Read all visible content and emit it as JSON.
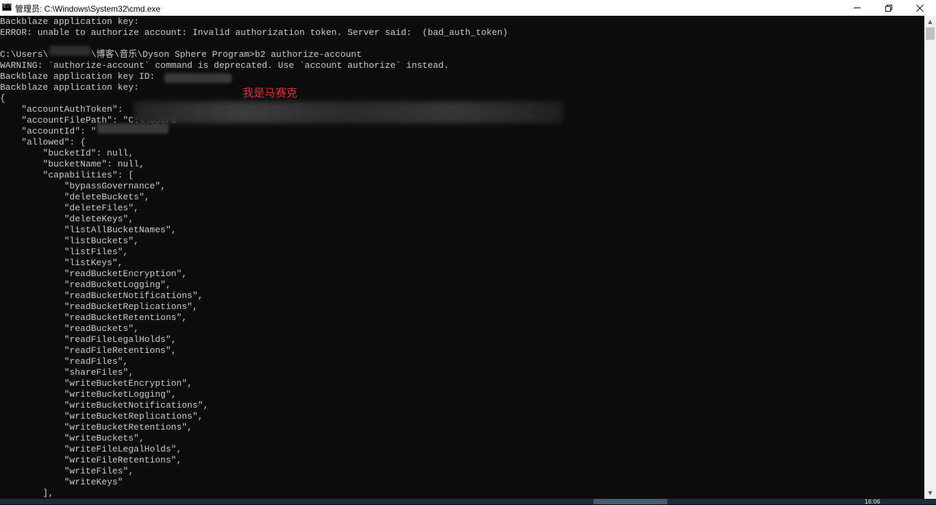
{
  "window": {
    "title": "管理员: C:\\Windows\\System32\\cmd.exe",
    "app_icon_text": "C:\\",
    "controls": {
      "minimize": "minimize",
      "maximize": "restore",
      "close": "close"
    }
  },
  "console": {
    "lines": [
      "Backblaze application key:",
      "ERROR: unable to authorize account: Invalid authorization token. Server said:  (bad_auth_token)",
      "",
      "C:\\Users\\        \\博客\\音乐\\Dyson Sphere Program>b2 authorize-account",
      "WARNING: `authorize-account` command is deprecated. Use `account authorize` instead.",
      "Backblaze application key ID:",
      "Backblaze application key:",
      "{",
      "    \"accountAuthToken\": ",
      "    \"accountFilePath\": \"C:\\\\Users",
      "    \"accountId\": \"",
      "    \"allowed\": {",
      "        \"bucketId\": null,",
      "        \"bucketName\": null,",
      "        \"capabilities\": [",
      "            \"bypassGovernance\",",
      "            \"deleteBuckets\",",
      "            \"deleteFiles\",",
      "            \"deleteKeys\",",
      "            \"listAllBucketNames\",",
      "            \"listBuckets\",",
      "            \"listFiles\",",
      "            \"listKeys\",",
      "            \"readBucketEncryption\",",
      "            \"readBucketLogging\",",
      "            \"readBucketNotifications\",",
      "            \"readBucketReplications\",",
      "            \"readBucketRetentions\",",
      "            \"readBuckets\",",
      "            \"readFileLegalHolds\",",
      "            \"readFileRetentions\",",
      "            \"readFiles\",",
      "            \"shareFiles\",",
      "            \"writeBucketEncryption\",",
      "            \"writeBucketLogging\",",
      "            \"writeBucketNotifications\",",
      "            \"writeBucketReplications\",",
      "            \"writeBucketRetentions\",",
      "            \"writeBuckets\",",
      "            \"writeFileLegalHolds\",",
      "            \"writeFileRetentions\",",
      "            \"writeFiles\",",
      "            \"writeKeys\"",
      "        ],"
    ]
  },
  "annotation": {
    "text": "我是马赛克",
    "color": "#e03030"
  },
  "scrollbar": {
    "up": "▲",
    "down": "▼"
  },
  "taskbar": {
    "clock": "16:06"
  },
  "colors": {
    "console_bg": "#0c0c0c",
    "console_text": "#cccccc",
    "titlebar_bg": "#ffffff",
    "taskbar_bg": "#1e2b3a"
  }
}
